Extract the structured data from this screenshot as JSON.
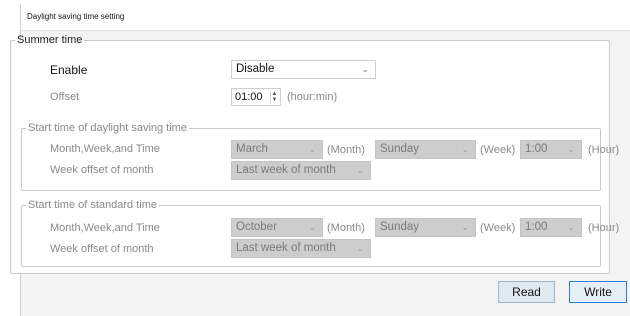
{
  "window": {
    "title": "Daylight saving time setting"
  },
  "summer": {
    "legend": "Summer time",
    "enable_label": "Enable",
    "enable_value": "Disable",
    "offset_label": "Offset",
    "offset_value": "01:00",
    "offset_unit": "(hour:min)"
  },
  "dst_start": {
    "legend": "Start time of daylight saving time",
    "mwt_label": "Month,Week,and Time",
    "month_value": "March",
    "month_unit": "(Month)",
    "week_value": "Sunday",
    "week_unit": "(Week)",
    "time_value": "1:00",
    "hour_unit": "(Hour)",
    "wom_label": "Week offset of month",
    "wom_value": "Last week of month"
  },
  "std_start": {
    "legend": "Start time of standard time",
    "mwt_label": "Month,Week,and Time",
    "month_value": "October",
    "month_unit": "(Month)",
    "week_value": "Sunday",
    "week_unit": "(Week)",
    "time_value": "1:00",
    "hour_unit": "(Hour)",
    "wom_label": "Week offset of month",
    "wom_value": "Last week of month"
  },
  "buttons": {
    "read": "Read",
    "write": "Write"
  },
  "icons": {
    "dropdown": "chevron-down-icon",
    "spinner": "spinner-arrows-icon"
  },
  "colors": {
    "disabled_fill": "#cdcdcd",
    "write_border": "#2c7fd0",
    "read_fill": "#dfe9f2"
  }
}
